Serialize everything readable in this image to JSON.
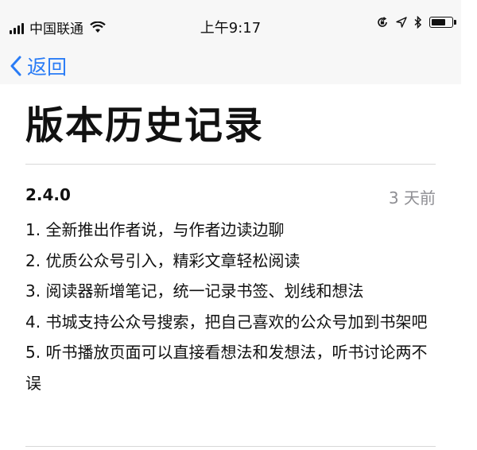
{
  "status_bar": {
    "carrier": "中国联通",
    "time": "上午9:17",
    "battery_level": 0.75,
    "icons": [
      "signal-bars-icon",
      "wifi-icon",
      "orientation-lock-icon",
      "location-arrow-icon",
      "bluetooth-icon",
      "battery-icon"
    ]
  },
  "nav": {
    "back_label": "返回",
    "back_icon": "chevron-left-icon",
    "accent_color": "#2a7cf6"
  },
  "page": {
    "title": "版本历史记录"
  },
  "release": {
    "version": "2.4.0",
    "time_ago": "3 天前",
    "notes": [
      "1. 全新推出作者说，与作者边读边聊",
      "2. 优质公众号引入，精彩文章轻松阅读",
      "3. 阅读器新增笔记，统一记录书签、划线和想法",
      "4. 书城支持公众号搜索，把自己喜欢的公众号加到书架吧",
      "5. 听书播放页面可以直接看想法和发想法，听书讨论两不误"
    ]
  }
}
